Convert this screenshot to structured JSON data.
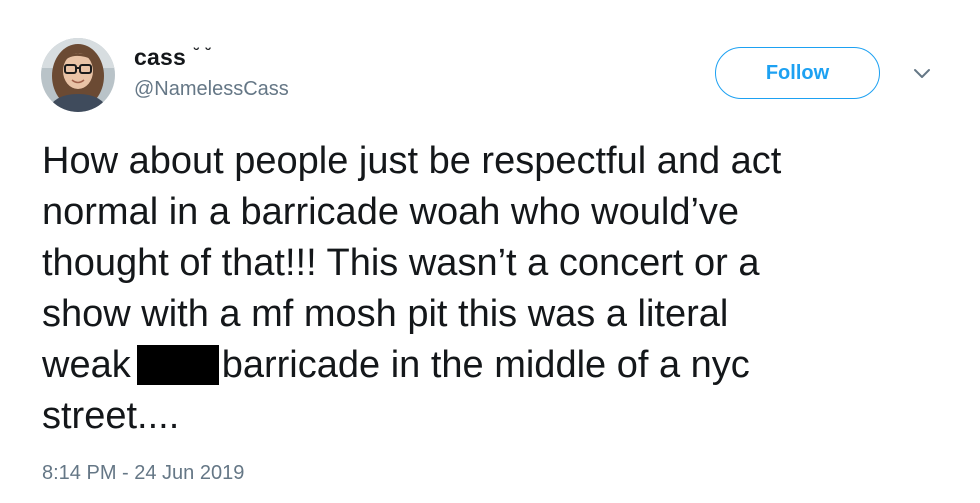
{
  "user": {
    "display_name": "cass",
    "name_emoticon": "˘ ˘",
    "handle": "@NamelessCass"
  },
  "actions": {
    "follow_label": "Follow",
    "menu_icon": "chevron-down-icon"
  },
  "tweet": {
    "lines": [
      "How about people just be respectful and act",
      "normal in a barricade woah who would’ve",
      "thought of that!!! This wasn’t a concert or a",
      "show with a mf mosh pit this was a literal"
    ],
    "line5_before": "weak",
    "line5_after": "barricade in the middle of a nyc",
    "line6": "street....",
    "timestamp": "8:14 PM - 24 Jun 2019"
  },
  "colors": {
    "accent": "#1da1f2",
    "text": "#14171a",
    "secondary": "#657786",
    "redaction": "#000000"
  }
}
